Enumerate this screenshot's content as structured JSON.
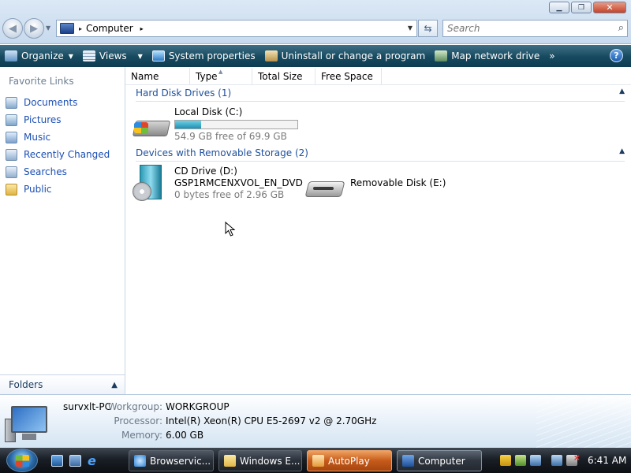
{
  "window": {
    "minimize_symbol": "▁",
    "maximize_symbol": "❐",
    "close_symbol": "✕"
  },
  "address_bar": {
    "crumb": "Computer",
    "separator": "▸",
    "trailing_arrow": "▸"
  },
  "search": {
    "placeholder": "Search"
  },
  "toolbar": {
    "organize": "Organize",
    "views": "Views",
    "system_properties": "System properties",
    "uninstall": "Uninstall or change a program",
    "map_drive": "Map network drive",
    "more": "»",
    "help": "?"
  },
  "sidebar": {
    "header": "Favorite Links",
    "items": [
      {
        "label": "Documents",
        "icon": "documents-icon"
      },
      {
        "label": "Pictures",
        "icon": "pictures-icon"
      },
      {
        "label": "Music",
        "icon": "music-icon"
      },
      {
        "label": "Recently Changed",
        "icon": "recently-changed-icon"
      },
      {
        "label": "Searches",
        "icon": "searches-icon"
      },
      {
        "label": "Public",
        "icon": "public-folder-icon"
      }
    ],
    "folders": "Folders"
  },
  "columns": [
    "Name",
    "Type",
    "Total Size",
    "Free Space"
  ],
  "groups": {
    "hard_disks": {
      "title": "Hard Disk Drives (1)",
      "drives": [
        {
          "name": "Local Disk (C:)",
          "free_text": "54.9 GB free of 69.9 GB",
          "used_fraction": 0.215
        }
      ]
    },
    "removable": {
      "title": "Devices with Removable Storage (2)",
      "drives": [
        {
          "name": "CD Drive (D:)",
          "label": "GSP1RMCENXVOL_EN_DVD",
          "free_text": "0 bytes free of 2.96 GB"
        },
        {
          "name": "Removable Disk (E:)"
        }
      ]
    }
  },
  "details": {
    "computer_name": "survxlt-PC",
    "workgroup_label": "Workgroup:",
    "workgroup": "WORKGROUP",
    "processor_label": "Processor:",
    "processor": "Intel(R) Xeon(R) CPU E5-2697 v2 @ 2.70GHz",
    "memory_label": "Memory:",
    "memory": "6.00 GB"
  },
  "taskbar": {
    "buttons": [
      {
        "label": "Browservic...",
        "icon": "ie-icon"
      },
      {
        "label": "Windows E...",
        "icon": "folder-icon"
      },
      {
        "label": "AutoPlay",
        "icon": "autoplay-icon"
      },
      {
        "label": "Computer",
        "icon": "computer-icon"
      }
    ],
    "clock": "6:41 AM"
  }
}
